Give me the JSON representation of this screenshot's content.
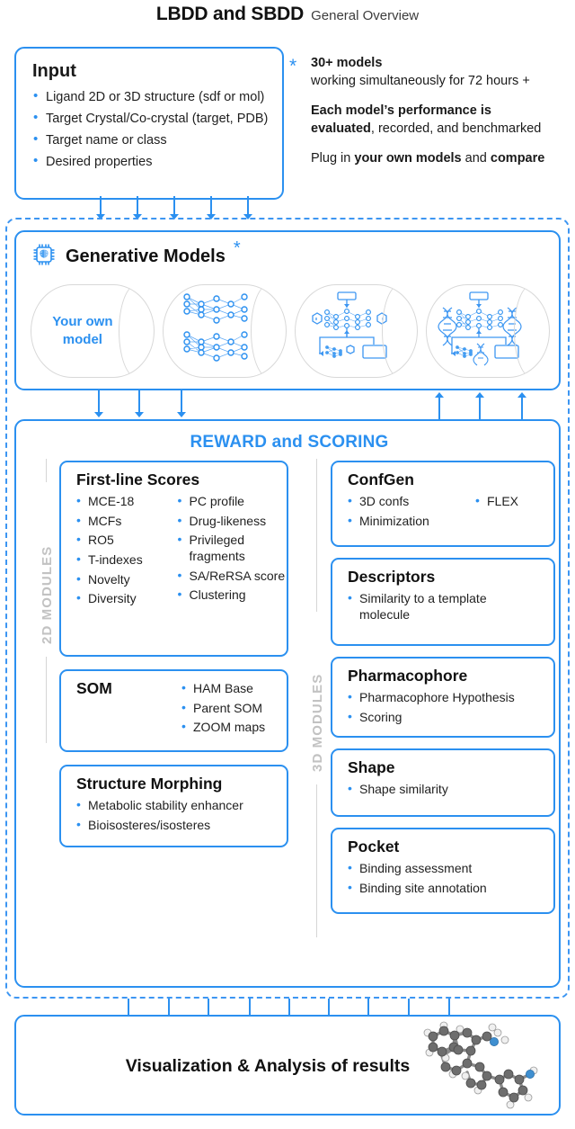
{
  "header": {
    "title": "LBDD and SBDD",
    "subtitle": "General Overview"
  },
  "colors": {
    "accent": "#2b90f0",
    "accent_dark": "#1a7fe0",
    "muted": "#c2c2c2",
    "text": "#1a1a1a"
  },
  "input": {
    "title": "Input",
    "items": [
      "Ligand 2D or 3D structure (sdf or mol)",
      "Target Crystal/Co-crystal (target, PDB)",
      "Target name or class",
      "Desired properties"
    ]
  },
  "annotation": {
    "star": "*",
    "line1_bold": "30+ models",
    "line1_rest": "working simultaneously for 72 hours +",
    "line2_bold_a": "Each model’s performance is",
    "line2_bold_b": "evaluated",
    "line2_rest": ", recorded, and benchmarked",
    "line3_pre": "Plug in ",
    "line3_bold_a": "your own models",
    "line3_mid": " and ",
    "line3_bold_b": "compare"
  },
  "generative": {
    "title": "Generative Models",
    "star": "*",
    "icon": "cpu-brain-icon",
    "cylinders": [
      {
        "label_line1": "Your own",
        "label_line2": "model",
        "art": "text"
      },
      {
        "art": "two-neural-networks"
      },
      {
        "art": "molecule-autoencoder"
      },
      {
        "art": "dna-autoencoder"
      }
    ]
  },
  "reward": {
    "title": "REWARD and SCORING",
    "label_2d": "2D MODULES",
    "label_3d": "3D MODULES",
    "modules_2d": [
      {
        "name": "First-line Scores",
        "col1": [
          "MCE-18",
          "MCFs",
          "RO5",
          "T-indexes",
          "Novelty",
          "Diversity"
        ],
        "col2": [
          "PC profile",
          "Drug-likeness",
          "Privileged fragments",
          "SA/ReRSA score",
          "Clustering"
        ]
      },
      {
        "name": "SOM",
        "col1": [],
        "col2": [
          "HAM Base",
          "Parent SOM",
          "ZOOM maps"
        ]
      },
      {
        "name": "Structure Morphing",
        "col1": [
          "Metabolic stability enhancer",
          "Bioisosteres/isosteres"
        ],
        "col2": []
      }
    ],
    "modules_3d": [
      {
        "name": "ConfGen",
        "col1": [
          "3D confs",
          "Minimization"
        ],
        "col2": [
          "FLEX"
        ]
      },
      {
        "name": "Descriptors",
        "col1": [
          "Similarity to a template molecule"
        ],
        "col2": []
      },
      {
        "name": "Pharmacophore",
        "col1": [
          "Pharmacophore Hypothesis",
          "Scoring"
        ],
        "col2": []
      },
      {
        "name": "Shape",
        "col1": [
          "Shape similarity"
        ],
        "col2": []
      },
      {
        "name": "Pocket",
        "col1": [
          "Binding assessment",
          "Binding site annotation"
        ],
        "col2": []
      }
    ]
  },
  "results": {
    "title": "Visualization & Analysis of results",
    "art": "3d-molecule-ball-and-stick"
  },
  "flow": {
    "arrows_input_to_generative": 5,
    "arrows_generative_to_reward_down": 3,
    "arrows_reward_to_generative_up": 3,
    "arrows_reward_to_results": 9
  }
}
